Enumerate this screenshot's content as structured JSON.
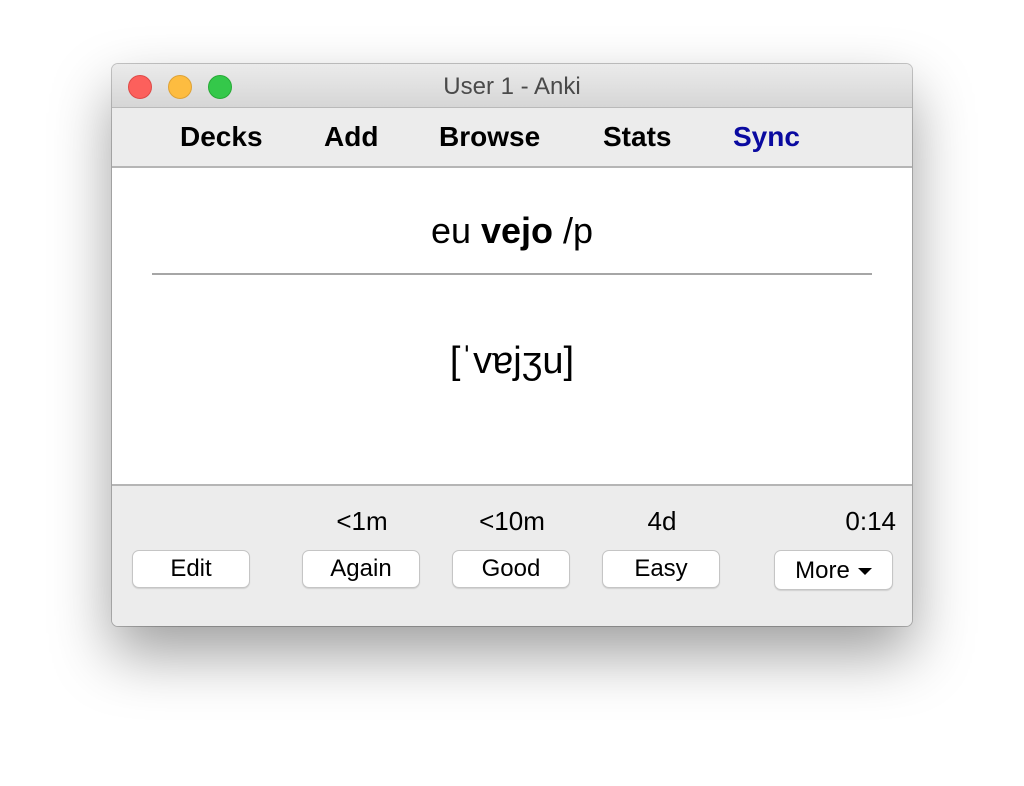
{
  "window": {
    "title": "User 1 - Anki"
  },
  "toolbar": {
    "decks": "Decks",
    "add": "Add",
    "browse": "Browse",
    "stats": "Stats",
    "sync": "Sync",
    "sync_color": "#0a0aa0"
  },
  "card": {
    "front_prefix": "eu ",
    "front_bold": "vejo",
    "front_suffix": " /p",
    "back": "[ˈvɐjʒu]"
  },
  "answer_bar": {
    "intervals": {
      "again": "<1m",
      "good": "<10m",
      "easy": "4d"
    },
    "timer": "0:14",
    "buttons": {
      "edit": "Edit",
      "again": "Again",
      "good": "Good",
      "easy": "Easy",
      "more": "More"
    },
    "more_icon": "caret-down-icon"
  }
}
